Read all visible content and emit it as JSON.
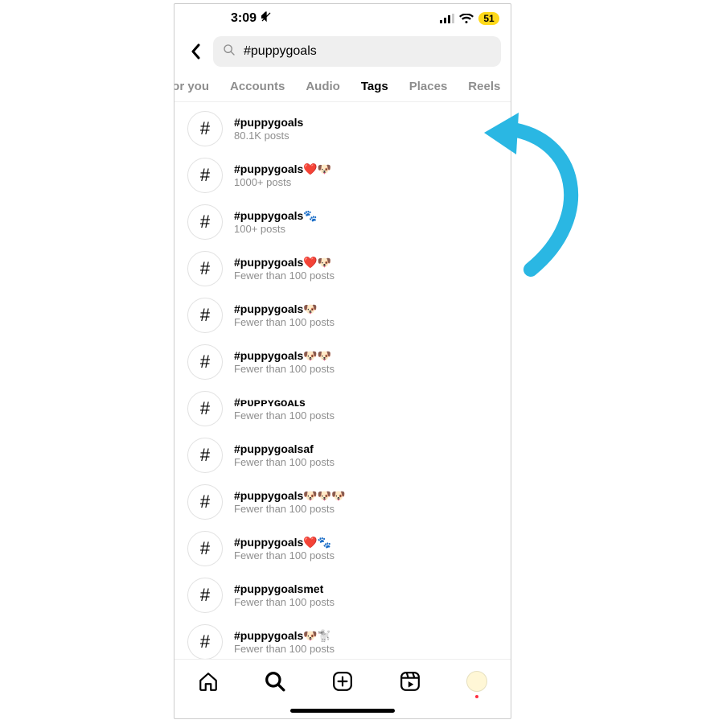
{
  "status": {
    "time": "3:09",
    "battery": "51"
  },
  "search": {
    "query": "#puppygoals"
  },
  "tabs": {
    "items": [
      {
        "label": "For you"
      },
      {
        "label": "Accounts"
      },
      {
        "label": "Audio"
      },
      {
        "label": "Tags"
      },
      {
        "label": "Places"
      },
      {
        "label": "Reels"
      }
    ],
    "active": "Tags"
  },
  "hash_symbol": "#",
  "results": [
    {
      "tag": "#puppygoals",
      "sub": "80.1K posts"
    },
    {
      "tag": "#puppygoals❤️🐶",
      "sub": "1000+ posts"
    },
    {
      "tag": "#puppygoals🐾",
      "sub": "100+ posts"
    },
    {
      "tag": "#puppygoals❤️🐶",
      "sub": "Fewer than 100 posts"
    },
    {
      "tag": "#puppygoals🐶",
      "sub": "Fewer than 100 posts"
    },
    {
      "tag": "#puppygoals🐶🐶",
      "sub": "Fewer than 100 posts"
    },
    {
      "tag": "#ᴘᴜᴘᴘʏɢᴏᴀʟs",
      "sub": "Fewer than 100 posts"
    },
    {
      "tag": "#puppygoalsaf",
      "sub": "Fewer than 100 posts"
    },
    {
      "tag": "#puppygoals🐶🐶🐶",
      "sub": "Fewer than 100 posts"
    },
    {
      "tag": "#puppygoals❤️🐾",
      "sub": "Fewer than 100 posts"
    },
    {
      "tag": "#puppygoalsmet",
      "sub": "Fewer than 100 posts"
    },
    {
      "tag": "#puppygoals🐶🐩",
      "sub": "Fewer than 100 posts"
    }
  ],
  "arrow_color": "#2ab7e3"
}
